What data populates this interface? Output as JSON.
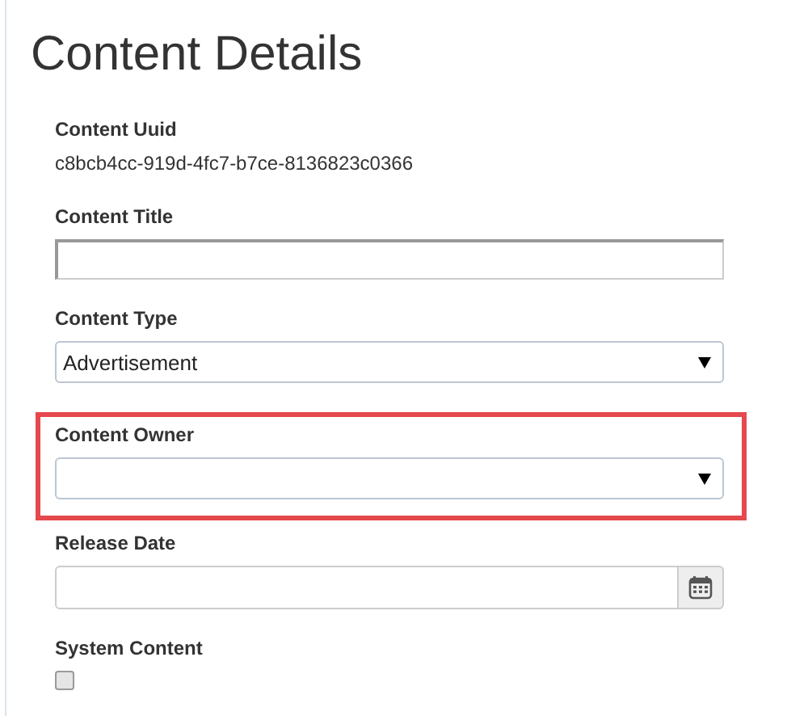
{
  "title": "Content Details",
  "fields": [
    {
      "kind": "static",
      "label": "Content Uuid",
      "value": "c8bcb4cc-919d-4fc7-b7ce-8136823c0366",
      "highlighted": false
    },
    {
      "kind": "text",
      "label": "Content Title",
      "highlighted": false
    },
    {
      "kind": "select",
      "label": "Content Type",
      "value": "Advertisement",
      "highlighted": false
    },
    {
      "kind": "select",
      "label": "Content Owner",
      "highlighted": true
    },
    {
      "kind": "date",
      "label": "Release Date",
      "highlighted": false
    },
    {
      "kind": "checkbox",
      "label": "System Content",
      "checked": false,
      "highlighted": false
    }
  ]
}
